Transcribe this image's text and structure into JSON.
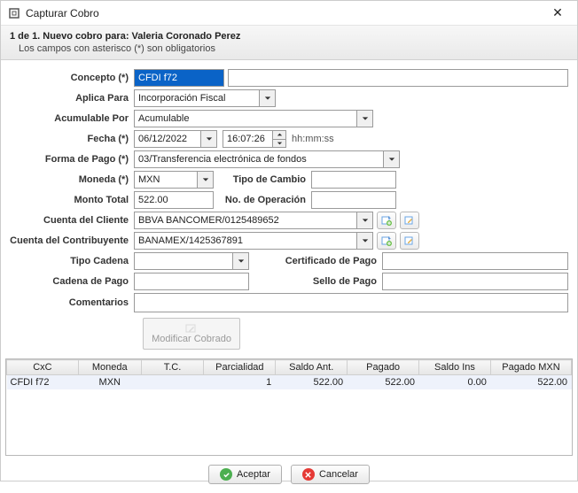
{
  "window": {
    "title": "Capturar Cobro"
  },
  "header": {
    "line1_prefix": "1 de 1. Nuevo cobro para: ",
    "line1_name": "Valeria Coronado Perez",
    "line2": "Los campos con asterisco (*) son obligatorios"
  },
  "labels": {
    "concepto": "Concepto (*)",
    "aplica_para": "Aplica Para",
    "acumulable_por": "Acumulable Por",
    "fecha": "Fecha (*)",
    "hhmmss": "hh:mm:ss",
    "forma_pago": "Forma de Pago (*)",
    "moneda": "Moneda (*)",
    "tipo_cambio": "Tipo de Cambio",
    "monto_total": "Monto Total",
    "no_operacion": "No. de Operación",
    "cuenta_cliente": "Cuenta del Cliente",
    "cuenta_contrib": "Cuenta del Contribuyente",
    "tipo_cadena": "Tipo Cadena",
    "cert_pago": "Certificado de Pago",
    "cadena_pago": "Cadena de Pago",
    "sello_pago": "Sello de Pago",
    "comentarios": "Comentarios",
    "modificar": "Modificar Cobrado"
  },
  "values": {
    "concepto": "CFDI f72",
    "aplica_para": "Incorporación Fiscal",
    "acumulable_por": "Acumulable",
    "fecha": "06/12/2022",
    "hora": "16:07:26",
    "forma_pago": "03/Transferencia electrónica de fondos",
    "moneda": "MXN",
    "tipo_cambio": "",
    "monto_total": "522.00",
    "no_operacion": "",
    "cuenta_cliente": "BBVA BANCOMER/0125489652",
    "cuenta_contrib": "BANAMEX/1425367891",
    "tipo_cadena": "",
    "cert_pago": "",
    "cadena_pago": "",
    "sello_pago": "",
    "comentarios": ""
  },
  "grid": {
    "headers": {
      "cxc": "CxC",
      "moneda": "Moneda",
      "tc": "T.C.",
      "parcialidad": "Parcialidad",
      "saldo_ant": "Saldo Ant.",
      "pagado": "Pagado",
      "saldo_ins": "Saldo Ins",
      "pagado_mxn": "Pagado MXN"
    },
    "row": {
      "cxc": "CFDI f72",
      "moneda": "MXN",
      "tc": "",
      "parcialidad": "1",
      "saldo_ant": "522.00",
      "pagado": "522.00",
      "saldo_ins": "0.00",
      "pagado_mxn": "522.00"
    }
  },
  "buttons": {
    "aceptar": "Aceptar",
    "cancelar": "Cancelar"
  }
}
